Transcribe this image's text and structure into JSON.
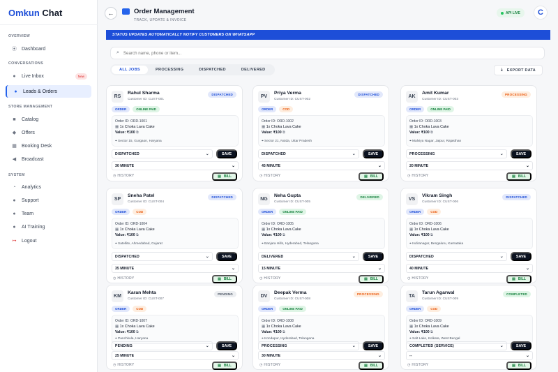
{
  "app": {
    "brand_a": "Omkun",
    "brand_b": " Chat"
  },
  "sidebar": {
    "sections": {
      "overview": "OVERVIEW",
      "conversations": "CONVERSATIONS",
      "store": "STORE MANAGEMENT",
      "system": "SYSTEM"
    },
    "items": [
      {
        "label": "Dashboard",
        "icon": "chart-icon"
      },
      {
        "label": "Live Inbox",
        "icon": "chat-icon",
        "badge": "New"
      },
      {
        "label": "Leads & Orders",
        "icon": "user-icon"
      },
      {
        "label": "Catalog",
        "icon": "box-icon"
      },
      {
        "label": "Offers",
        "icon": "tag-icon"
      },
      {
        "label": "Booking Desk",
        "icon": "calendar-icon"
      },
      {
        "label": "Broadcast",
        "icon": "megaphone-icon"
      },
      {
        "label": "Analytics",
        "icon": "pie-icon"
      },
      {
        "label": "Support",
        "icon": "help-icon"
      },
      {
        "label": "Team",
        "icon": "team-icon"
      },
      {
        "label": "AI Training",
        "icon": "robot-icon"
      },
      {
        "label": "Logout",
        "icon": "logout-icon"
      }
    ]
  },
  "header": {
    "title": "Order Management",
    "subtitle": "TRACK, UPDATE & INVOICE",
    "api": "API LIVE",
    "avatar": "C"
  },
  "banner": "STATUS UPDATES AUTOMATICALLY NOTIFY CUSTOMERS ON WHATSAPP",
  "search": {
    "placeholder": "Search name, phone or item..."
  },
  "tabs": [
    "ALL JOBS",
    "PROCESSING",
    "DISPATCHED",
    "DELIVERED"
  ],
  "export": "EXPORT DATA",
  "labels": {
    "save": "SAVE",
    "history": "HISTORY",
    "bill": "BILL",
    "order_tag": "ORDER",
    "qty": "1x"
  },
  "cards": [
    {
      "initials": "RS",
      "name": "Rahul Sharma",
      "cid": "Customer ID: CUST-001",
      "status": "DISPATCHED",
      "pay": "ONLINE PAID",
      "order": "Order ID: ORD-1001",
      "item": "Choka Lava Cake",
      "value": "Value: ₹100",
      "addr": "Sector 15, Gurgaon, Haryana",
      "sel": "DISPATCHED",
      "time": "30 MINUTE"
    },
    {
      "initials": "PV",
      "name": "Priya Verma",
      "cid": "Customer ID: CUST-002",
      "status": "DISPATCHED",
      "pay": "COD",
      "order": "Order ID: ORD-1002",
      "item": "Choka Lava Cake",
      "value": "Value: ₹100",
      "addr": "Sector 21, Noida, Uttar Pradesh",
      "sel": "DISPATCHED",
      "time": "45 MINUTE"
    },
    {
      "initials": "AK",
      "name": "Amit Kumar",
      "cid": "Customer ID: CUST-003",
      "status": "PROCESSING",
      "pay": "ONLINE PAID",
      "order": "Order ID: ORD-1003",
      "item": "Choka Lava Cake",
      "value": "Value: ₹100",
      "addr": "Malviya Nagar, Jaipur, Rajasthan",
      "sel": "PROCESSING",
      "time": "20 MINUTE"
    },
    {
      "initials": "SP",
      "name": "Sneha Patel",
      "cid": "Customer ID: CUST-004",
      "status": "DISPATCHED",
      "pay": "COD",
      "order": "Order ID: ORD-1004",
      "item": "Choka Lava Cake",
      "value": "Value: ₹100",
      "addr": "Satellite, Ahmedabad, Gujarat",
      "sel": "DISPATCHED",
      "time": "35 MINUTE"
    },
    {
      "initials": "NG",
      "name": "Neha Gupta",
      "cid": "Customer ID: CUST-005",
      "status": "DELIVERED",
      "pay": "ONLINE PAID",
      "order": "Order ID: ORD-1005",
      "item": "Choka Lava Cake",
      "value": "Value: ₹100",
      "addr": "Banjara Hills, Hyderabad, Telangana",
      "sel": "DELIVERED",
      "time": "15 MINUTE"
    },
    {
      "initials": "VS",
      "name": "Vikram Singh",
      "cid": "Customer ID: CUST-006",
      "status": "DISPATCHED",
      "pay": "COD",
      "order": "Order ID: ORD-1006",
      "item": "Choka Lava Cake",
      "value": "Value: ₹100",
      "addr": "Indiranagar, Bengaluru, Karnataka",
      "sel": "DISPATCHED",
      "time": "40 MINUTE"
    },
    {
      "initials": "KM",
      "name": "Karan Mehta",
      "cid": "Customer ID: CUST-007",
      "status": "PENDING",
      "pay": "COD",
      "order": "Order ID: ORD-1007",
      "item": "Choka Lava Cake",
      "value": "Value: ₹100",
      "addr": "Panchkula, Haryana",
      "sel": "PENDING",
      "time": "25 MINUTE"
    },
    {
      "initials": "DV",
      "name": "Deepak Verma",
      "cid": "Customer ID: CUST-008",
      "status": "PROCESSING",
      "pay": "ONLINE PAID",
      "order": "Order ID: ORD-1008",
      "item": "Choka Lava Cake",
      "value": "Value: ₹100",
      "addr": "Kondapur, Hyderabad, Telangana",
      "sel": "PROCESSING",
      "time": "30 MINUTE"
    },
    {
      "initials": "TA",
      "name": "Tarun Agarwal",
      "cid": "Customer ID: CUST-009",
      "status": "COMPLETED",
      "pay": "COD",
      "order": "Order ID: ORD-1009",
      "item": "Choka Lava Cake",
      "value": "Value: ₹100",
      "addr": "Salt Lake, Kolkata, West Bengal",
      "sel": "COMPLETED (SERVICE)",
      "time": "--"
    }
  ]
}
